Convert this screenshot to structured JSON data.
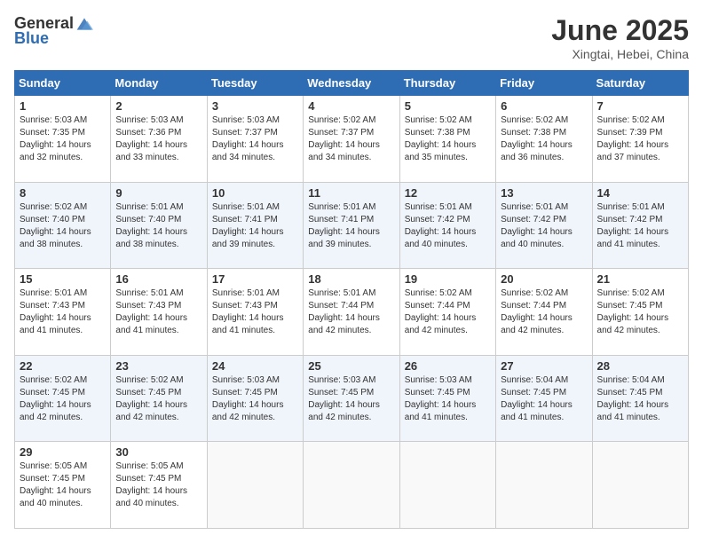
{
  "header": {
    "logo_general": "General",
    "logo_blue": "Blue",
    "title": "June 2025",
    "subtitle": "Xingtai, Hebei, China"
  },
  "weekdays": [
    "Sunday",
    "Monday",
    "Tuesday",
    "Wednesday",
    "Thursday",
    "Friday",
    "Saturday"
  ],
  "weeks": [
    [
      {
        "day": "1",
        "sunrise": "5:03 AM",
        "sunset": "7:35 PM",
        "daylight": "14 hours and 32 minutes."
      },
      {
        "day": "2",
        "sunrise": "5:03 AM",
        "sunset": "7:36 PM",
        "daylight": "14 hours and 33 minutes."
      },
      {
        "day": "3",
        "sunrise": "5:03 AM",
        "sunset": "7:37 PM",
        "daylight": "14 hours and 34 minutes."
      },
      {
        "day": "4",
        "sunrise": "5:02 AM",
        "sunset": "7:37 PM",
        "daylight": "14 hours and 34 minutes."
      },
      {
        "day": "5",
        "sunrise": "5:02 AM",
        "sunset": "7:38 PM",
        "daylight": "14 hours and 35 minutes."
      },
      {
        "day": "6",
        "sunrise": "5:02 AM",
        "sunset": "7:38 PM",
        "daylight": "14 hours and 36 minutes."
      },
      {
        "day": "7",
        "sunrise": "5:02 AM",
        "sunset": "7:39 PM",
        "daylight": "14 hours and 37 minutes."
      }
    ],
    [
      {
        "day": "8",
        "sunrise": "5:02 AM",
        "sunset": "7:40 PM",
        "daylight": "14 hours and 38 minutes."
      },
      {
        "day": "9",
        "sunrise": "5:01 AM",
        "sunset": "7:40 PM",
        "daylight": "14 hours and 38 minutes."
      },
      {
        "day": "10",
        "sunrise": "5:01 AM",
        "sunset": "7:41 PM",
        "daylight": "14 hours and 39 minutes."
      },
      {
        "day": "11",
        "sunrise": "5:01 AM",
        "sunset": "7:41 PM",
        "daylight": "14 hours and 39 minutes."
      },
      {
        "day": "12",
        "sunrise": "5:01 AM",
        "sunset": "7:42 PM",
        "daylight": "14 hours and 40 minutes."
      },
      {
        "day": "13",
        "sunrise": "5:01 AM",
        "sunset": "7:42 PM",
        "daylight": "14 hours and 40 minutes."
      },
      {
        "day": "14",
        "sunrise": "5:01 AM",
        "sunset": "7:42 PM",
        "daylight": "14 hours and 41 minutes."
      }
    ],
    [
      {
        "day": "15",
        "sunrise": "5:01 AM",
        "sunset": "7:43 PM",
        "daylight": "14 hours and 41 minutes."
      },
      {
        "day": "16",
        "sunrise": "5:01 AM",
        "sunset": "7:43 PM",
        "daylight": "14 hours and 41 minutes."
      },
      {
        "day": "17",
        "sunrise": "5:01 AM",
        "sunset": "7:43 PM",
        "daylight": "14 hours and 41 minutes."
      },
      {
        "day": "18",
        "sunrise": "5:01 AM",
        "sunset": "7:44 PM",
        "daylight": "14 hours and 42 minutes."
      },
      {
        "day": "19",
        "sunrise": "5:02 AM",
        "sunset": "7:44 PM",
        "daylight": "14 hours and 42 minutes."
      },
      {
        "day": "20",
        "sunrise": "5:02 AM",
        "sunset": "7:44 PM",
        "daylight": "14 hours and 42 minutes."
      },
      {
        "day": "21",
        "sunrise": "5:02 AM",
        "sunset": "7:45 PM",
        "daylight": "14 hours and 42 minutes."
      }
    ],
    [
      {
        "day": "22",
        "sunrise": "5:02 AM",
        "sunset": "7:45 PM",
        "daylight": "14 hours and 42 minutes."
      },
      {
        "day": "23",
        "sunrise": "5:02 AM",
        "sunset": "7:45 PM",
        "daylight": "14 hours and 42 minutes."
      },
      {
        "day": "24",
        "sunrise": "5:03 AM",
        "sunset": "7:45 PM",
        "daylight": "14 hours and 42 minutes."
      },
      {
        "day": "25",
        "sunrise": "5:03 AM",
        "sunset": "7:45 PM",
        "daylight": "14 hours and 42 minutes."
      },
      {
        "day": "26",
        "sunrise": "5:03 AM",
        "sunset": "7:45 PM",
        "daylight": "14 hours and 41 minutes."
      },
      {
        "day": "27",
        "sunrise": "5:04 AM",
        "sunset": "7:45 PM",
        "daylight": "14 hours and 41 minutes."
      },
      {
        "day": "28",
        "sunrise": "5:04 AM",
        "sunset": "7:45 PM",
        "daylight": "14 hours and 41 minutes."
      }
    ],
    [
      {
        "day": "29",
        "sunrise": "5:05 AM",
        "sunset": "7:45 PM",
        "daylight": "14 hours and 40 minutes."
      },
      {
        "day": "30",
        "sunrise": "5:05 AM",
        "sunset": "7:45 PM",
        "daylight": "14 hours and 40 minutes."
      },
      null,
      null,
      null,
      null,
      null
    ]
  ]
}
